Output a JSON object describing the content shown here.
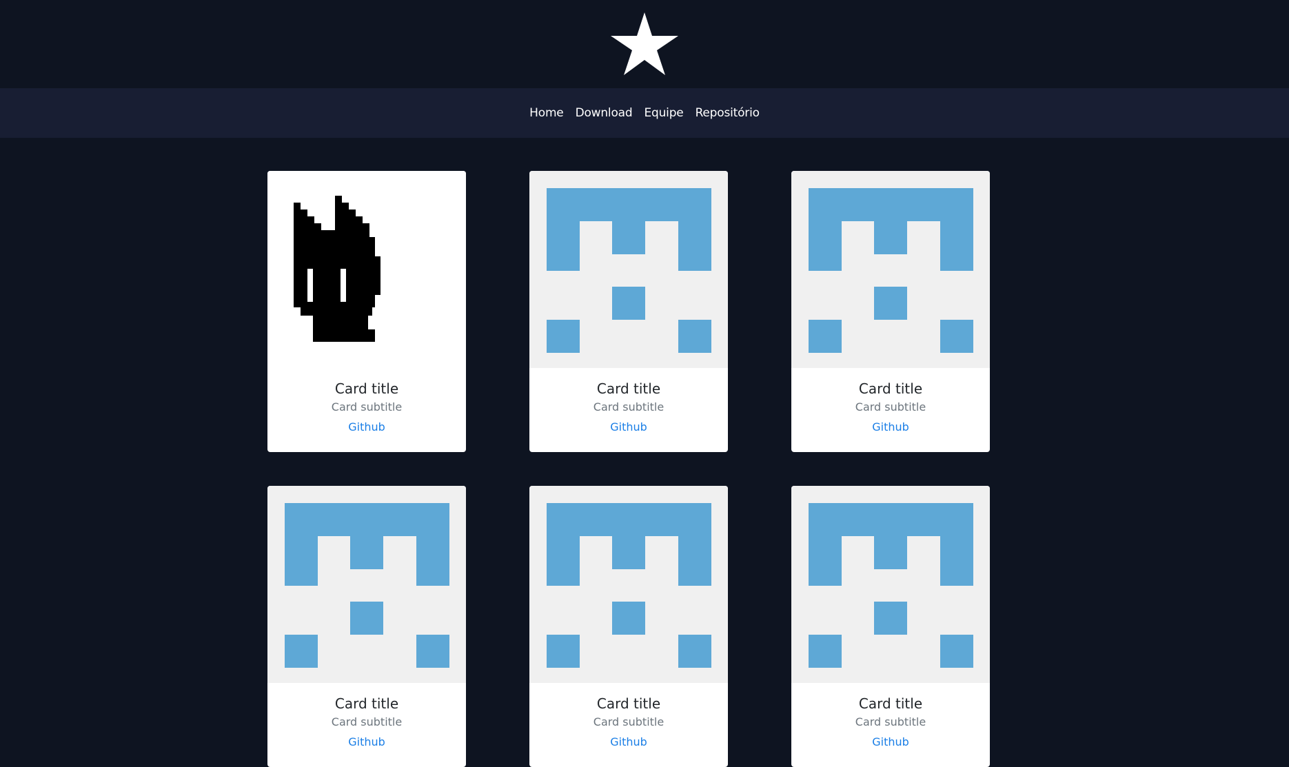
{
  "logo": {
    "icon": "star-icon",
    "color": "#ffffff"
  },
  "nav": {
    "items": [
      {
        "label": "Home"
      },
      {
        "label": "Download"
      },
      {
        "label": "Equipe"
      },
      {
        "label": "Repositório"
      }
    ]
  },
  "cards": [
    {
      "image": "pixel-cat",
      "title": "Card title",
      "subtitle": "Card subtitle",
      "link": "Github"
    },
    {
      "image": "identicon",
      "title": "Card title",
      "subtitle": "Card subtitle",
      "link": "Github"
    },
    {
      "image": "identicon",
      "title": "Card title",
      "subtitle": "Card subtitle",
      "link": "Github"
    },
    {
      "image": "identicon",
      "title": "Card title",
      "subtitle": "Card subtitle",
      "link": "Github"
    },
    {
      "image": "identicon",
      "title": "Card title",
      "subtitle": "Card subtitle",
      "link": "Github"
    },
    {
      "image": "identicon",
      "title": "Card title",
      "subtitle": "Card subtitle",
      "link": "Github"
    }
  ],
  "colors": {
    "background": "#0e1421",
    "navbar": "#181e33",
    "identicon": "#5ea8d6",
    "link": "#1a7ee6"
  }
}
